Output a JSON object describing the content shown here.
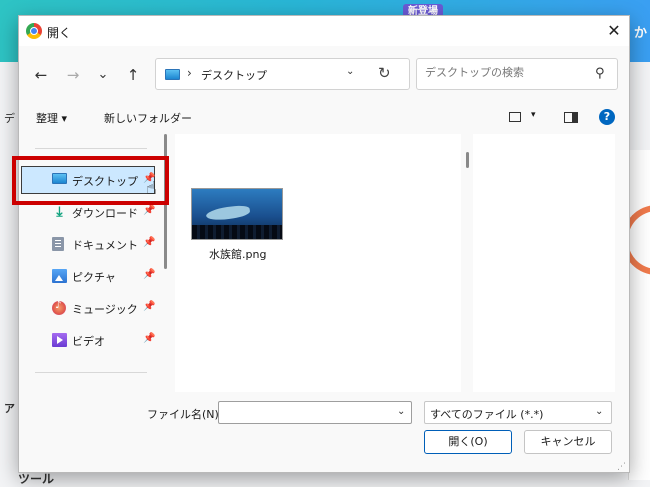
{
  "background": {
    "badge": "新登場",
    "right_text": "か",
    "left_texts": [
      "デ",
      "ア",
      "ツール"
    ]
  },
  "dialog": {
    "title": "開く",
    "close_glyph": "✕",
    "nav": {
      "back": "←",
      "forward": "→",
      "recent": "⌄",
      "up": "↑"
    },
    "address": {
      "separator": "›",
      "path": "デスクトップ",
      "dropdown": "⌄",
      "refresh": "↻"
    },
    "search": {
      "placeholder": "デスクトップの検索",
      "icon": "⚲"
    },
    "toolbar": {
      "organize": "整理 ▾",
      "new_folder": "新しいフォルダー",
      "view_dropdown": "▾",
      "help": "?"
    },
    "sidebar": {
      "items": [
        {
          "label": "デスクトップ",
          "icon": "desktop-icon",
          "pin": "📌"
        },
        {
          "label": "ダウンロード",
          "icon": "download-icon",
          "pin": "📌"
        },
        {
          "label": "ドキュメント",
          "icon": "document-icon",
          "pin": "📌"
        },
        {
          "label": "ピクチャ",
          "icon": "picture-icon",
          "pin": "📌"
        },
        {
          "label": "ミュージック",
          "icon": "music-icon",
          "pin": "📌"
        },
        {
          "label": "ビデオ",
          "icon": "video-icon",
          "pin": "📌"
        }
      ],
      "download_glyph": "⤓"
    },
    "files": [
      {
        "name": "水族館.png"
      }
    ],
    "bottom": {
      "filename_label": "ファイル名(N):",
      "filename_value": "",
      "filename_dropdown": "⌄",
      "filetype": "すべてのファイル (*.*)",
      "filetype_dropdown": "⌄",
      "open_button": "開く(O)",
      "cancel_button": "キャンセル"
    }
  },
  "colors": {
    "highlight_frame": "#cc0000",
    "selection": "#cce8ff",
    "accent": "#005fb8"
  }
}
